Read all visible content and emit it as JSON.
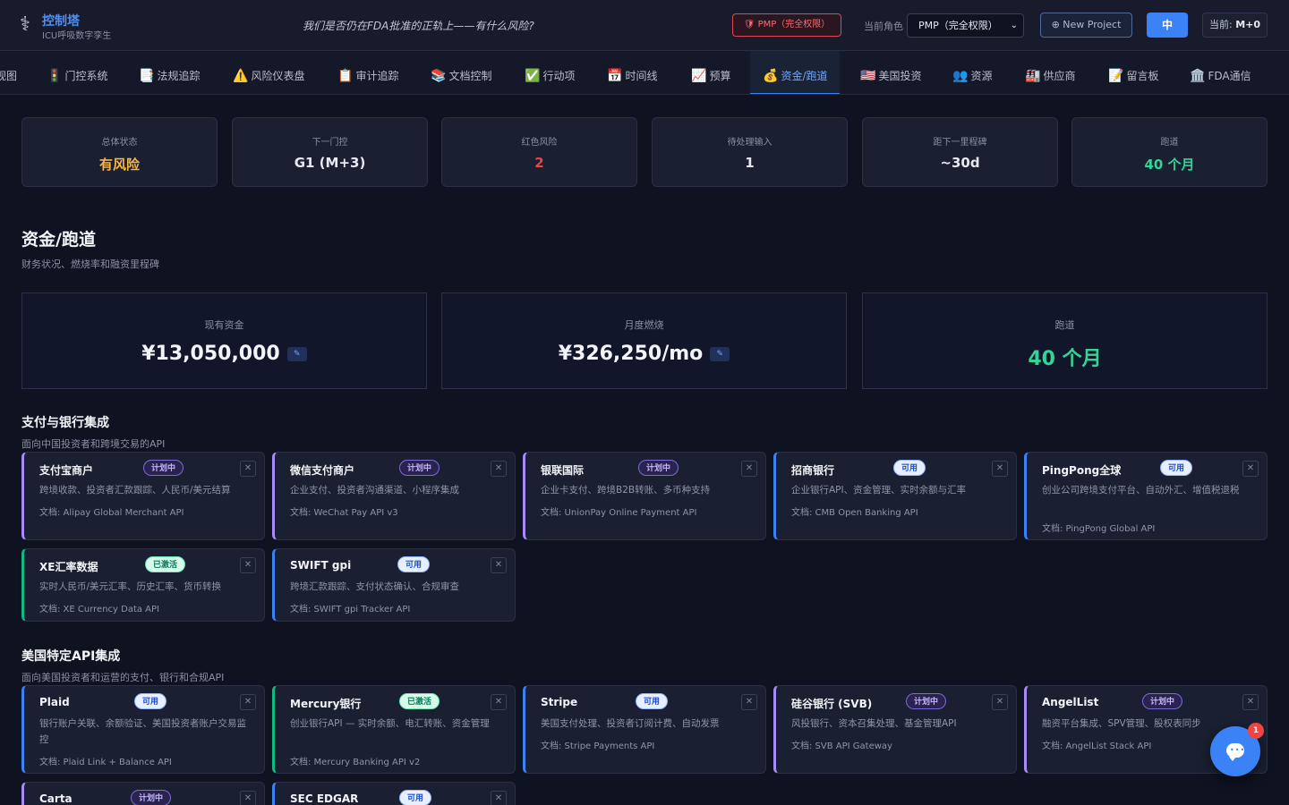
{
  "header": {
    "title": "控制塔",
    "subtitle": "ICU呼吸数字孪生",
    "tagline": "我们是否仍在FDA批准的正轨上——有什么风险?",
    "pmp_badge": "PMP（完全权限）",
    "role_label": "当前角色",
    "role_value": "PMP（完全权限）",
    "new_project": "⊕ New Project",
    "lang": "中",
    "current_prefix": "当前: ",
    "current_value": "M+0"
  },
  "tabs": [
    {
      "icon": "",
      "label": "视图"
    },
    {
      "icon": "🚦",
      "label": "门控系统"
    },
    {
      "icon": "📑",
      "label": "法规追踪"
    },
    {
      "icon": "⚠️",
      "label": "风险仪表盘"
    },
    {
      "icon": "📋",
      "label": "审计追踪"
    },
    {
      "icon": "📚",
      "label": "文档控制"
    },
    {
      "icon": "✅",
      "label": "行动项"
    },
    {
      "icon": "📅",
      "label": "时间线"
    },
    {
      "icon": "📈",
      "label": "预算"
    },
    {
      "icon": "💰",
      "label": "资金/跑道",
      "active": true
    },
    {
      "icon": "🇺🇸",
      "label": "美国投资"
    },
    {
      "icon": "👥",
      "label": "资源"
    },
    {
      "icon": "🏭",
      "label": "供应商"
    },
    {
      "icon": "📝",
      "label": "留言板"
    },
    {
      "icon": "🏛️",
      "label": "FDA通信"
    }
  ],
  "stats": [
    {
      "label": "总体状态",
      "value": "有风险",
      "tone": "amber"
    },
    {
      "label": "下一门控",
      "value": "G1 (M+3)",
      "tone": ""
    },
    {
      "label": "红色风险",
      "value": "2",
      "tone": "red"
    },
    {
      "label": "待处理输入",
      "value": "1",
      "tone": ""
    },
    {
      "label": "距下一里程碑",
      "value": "~30d",
      "tone": ""
    },
    {
      "label": "跑道",
      "value": "40 个月",
      "tone": "green"
    }
  ],
  "section": {
    "title": "资金/跑道",
    "subtitle": "财务状况、燃烧率和融资里程碑"
  },
  "finance": {
    "cash_label": "现有资金",
    "cash_value": "¥13,050,000",
    "burn_label": "月度燃烧",
    "burn_value": "¥326,250/mo",
    "runway_label": "跑道",
    "runway_value": "40 个月",
    "edit_glyph": "✎"
  },
  "cn_group": {
    "title": "支付与银行集成",
    "subtitle": "面向中国投资者和跨境交易的API",
    "items": [
      {
        "name": "支付宝商户",
        "status": "计划中",
        "kind": "planned",
        "desc": "跨境收款、投资者汇款跟踪、人民币/美元结算",
        "doc": "文档: Alipay Global Merchant API"
      },
      {
        "name": "微信支付商户",
        "status": "计划中",
        "kind": "planned",
        "desc": "企业支付、投资者沟通渠道、小程序集成",
        "doc": "文档: WeChat Pay API v3"
      },
      {
        "name": "银联国际",
        "status": "计划中",
        "kind": "planned",
        "desc": "企业卡支付、跨境B2B转账、多币种支持",
        "doc": "文档: UnionPay Online Payment API"
      },
      {
        "name": "招商银行",
        "status": "可用",
        "kind": "available",
        "desc": "企业银行API、资金管理、实时余额与汇率",
        "doc": "文档: CMB Open Banking API"
      },
      {
        "name": "PingPong全球",
        "status": "可用",
        "kind": "available",
        "desc": "创业公司跨境支付平台、自动外汇、增值税退税",
        "doc": "文档: PingPong Global API"
      },
      {
        "name": "XE汇率数据",
        "status": "已激活",
        "kind": "active",
        "desc": "实时人民币/美元汇率、历史汇率、货币转换",
        "doc": "文档: XE Currency Data API"
      },
      {
        "name": "SWIFT gpi",
        "status": "可用",
        "kind": "available",
        "desc": "跨境汇款跟踪、支付状态确认、合规审查",
        "doc": "文档: SWIFT gpi Tracker API"
      }
    ]
  },
  "us_group": {
    "title": "美国特定API集成",
    "subtitle": "面向美国投资者和运营的支付、银行和合规API",
    "items": [
      {
        "name": "Plaid",
        "status": "可用",
        "kind": "available",
        "desc": "银行账户关联、余额验证、美国投资者账户交易监控",
        "doc": "文档: Plaid Link + Balance API"
      },
      {
        "name": "Mercury银行",
        "status": "已激活",
        "kind": "active",
        "desc": "创业银行API — 实时余额、电汇转账、资金管理",
        "doc": "文档: Mercury Banking API v2"
      },
      {
        "name": "Stripe",
        "status": "可用",
        "kind": "available",
        "desc": "美国支付处理、投资者订阅计费、自动发票",
        "doc": "文档: Stripe Payments API"
      },
      {
        "name": "硅谷银行 (SVB)",
        "status": "计划中",
        "kind": "planned",
        "desc": "风投银行、资本召集处理、基金管理API",
        "doc": "文档: SVB API Gateway"
      },
      {
        "name": "AngelList",
        "status": "计划中",
        "kind": "planned",
        "desc": "融资平台集成、SPV管理、股权表同步",
        "doc": "文档: AngelList Stack API"
      },
      {
        "name": "Carta",
        "status": "计划中",
        "kind": "planned",
        "desc": "",
        "doc": ""
      },
      {
        "name": "SEC EDGAR",
        "status": "可用",
        "kind": "available",
        "desc": "",
        "doc": ""
      }
    ]
  },
  "close_glyph": "✕",
  "chat": {
    "badge": "1"
  }
}
